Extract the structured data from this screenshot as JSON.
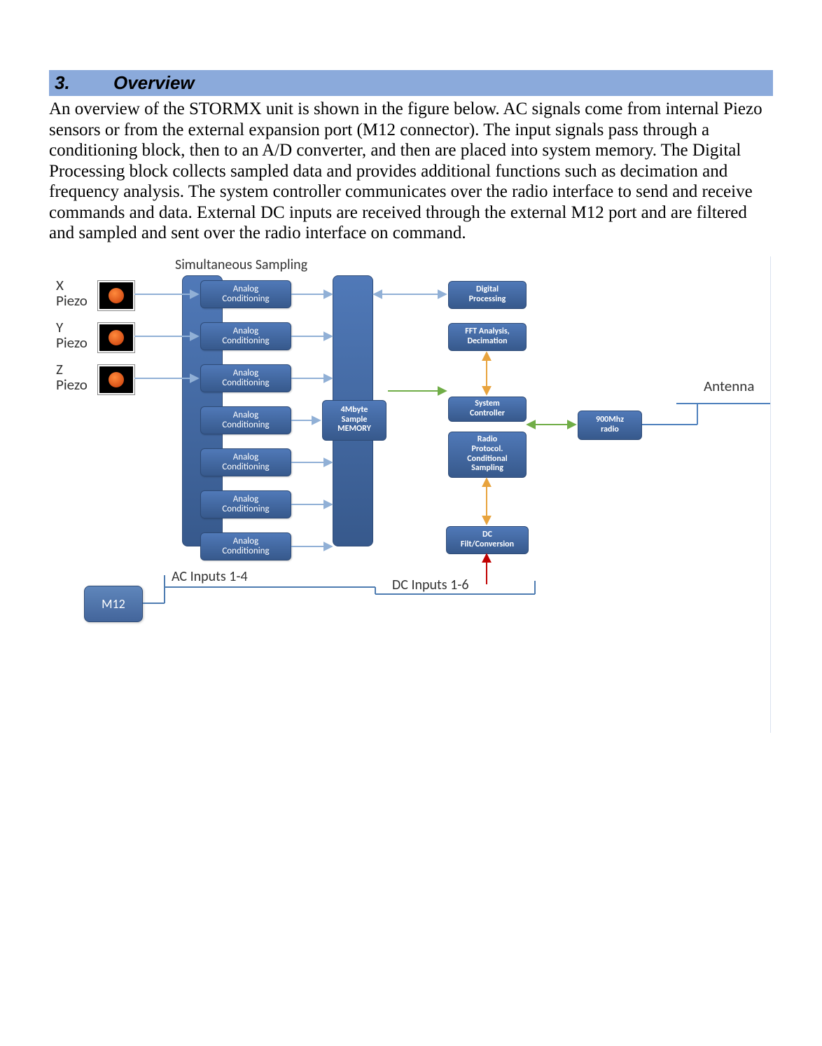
{
  "section": {
    "number": "3.",
    "title": "Overview"
  },
  "paragraph": "An overview of the STORMX unit is shown in the figure below.  AC signals come from internal Piezo sensors or from the external expansion port (M12 connector).  The input signals pass through a conditioning block, then to an A/D converter, and then are placed into system memory.  The Digital Processing block collects sampled data and provides additional functions such as decimation and frequency analysis.  The system controller communicates over the radio interface to send and receive commands and data.  External DC inputs are received through the external M12 port and are filtered and sampled and sent over the radio interface on command.",
  "diagram": {
    "simultaneous_sampling": "Simultaneous Sampling",
    "piezo_x": "X\nPiezo",
    "piezo_y": "Y\nPiezo",
    "piezo_z": "Z\nPiezo",
    "analog_cond_line1": "Analog",
    "analog_cond_line2": "Conditioning",
    "memory_l1": "4Mbyte",
    "memory_l2": "Sample",
    "memory_l3": "MEMORY",
    "digital_proc_l1": "Digital",
    "digital_proc_l2": "Processing",
    "fft_l1": "FFT Analysis,",
    "fft_l2": "Decimation",
    "sys_l1": "System",
    "sys_l2": "Controller",
    "radproto_l1": "Radio",
    "radproto_l2": "Protocol.",
    "radproto_l3": "Conditional",
    "radproto_l4": "Sampling",
    "radio_l1": "900Mhz",
    "radio_l2": "radio",
    "dc_l1": "DC",
    "dc_l2": "Filt/Conversion",
    "antenna": "Antenna",
    "m12": "M12",
    "ac_inputs": "AC Inputs 1-4",
    "dc_inputs": "DC Inputs 1-6"
  }
}
